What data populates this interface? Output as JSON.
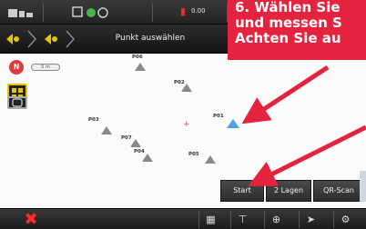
{
  "statusbar": {
    "value_text": "0.00"
  },
  "header": {
    "title": "Punkt auswählen"
  },
  "map": {
    "compass_label": "N",
    "scale_label": "5 m",
    "points": [
      {
        "label": "P06",
        "color": "grey"
      },
      {
        "label": "P02",
        "color": "grey"
      },
      {
        "label": "P01",
        "color": "blue"
      },
      {
        "label": "P03",
        "color": "grey"
      },
      {
        "label": "P07",
        "color": "grey"
      },
      {
        "label": "P04",
        "color": "grey"
      },
      {
        "label": "P05",
        "color": "grey"
      }
    ]
  },
  "actions": {
    "start_label": "Start",
    "layers_label": "2 Lagen",
    "qr_label": "QR-Scan"
  },
  "toolbar": {
    "cancel_label": "✖"
  },
  "annotation": {
    "line1": "6. Wählen Sie",
    "line2": "und messen S",
    "line3": "Achten Sie au"
  },
  "colors": {
    "accent_red": "#e4233f",
    "point_blue": "#4aa2e8",
    "side_yellow": "#e8c400"
  }
}
